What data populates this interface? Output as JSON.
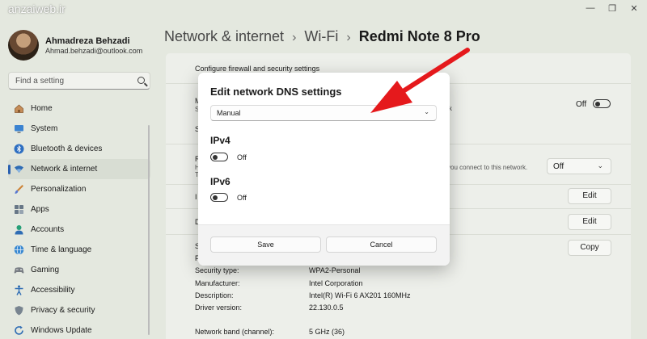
{
  "watermark": "anzaiweb.ir",
  "window": {
    "minimize": "—",
    "maximize": "❐",
    "close": "✕"
  },
  "profile": {
    "name": "Ahmadreza Behzadi",
    "email": "Ahmad.behzadi@outlook.com"
  },
  "search": {
    "placeholder": "Find a setting"
  },
  "sidebar": {
    "items": [
      {
        "label": "Home",
        "icon": "home-icon"
      },
      {
        "label": "System",
        "icon": "monitor-icon"
      },
      {
        "label": "Bluetooth & devices",
        "icon": "bluetooth-icon"
      },
      {
        "label": "Network & internet",
        "icon": "wifi-icon",
        "active": true
      },
      {
        "label": "Personalization",
        "icon": "brush-icon"
      },
      {
        "label": "Apps",
        "icon": "apps-icon"
      },
      {
        "label": "Accounts",
        "icon": "person-icon"
      },
      {
        "label": "Time & language",
        "icon": "globe-icon"
      },
      {
        "label": "Gaming",
        "icon": "gamepad-icon"
      },
      {
        "label": "Accessibility",
        "icon": "accessibility-icon"
      },
      {
        "label": "Privacy & security",
        "icon": "shield-icon"
      },
      {
        "label": "Windows Update",
        "icon": "update-icon"
      }
    ]
  },
  "breadcrumb": {
    "part1": "Network & internet",
    "sep1": "›",
    "part2": "Wi-Fi",
    "sep2": "›",
    "current": "Redmi Note 8 Pro"
  },
  "main": {
    "firewall_text": "Configure firewall and security settings",
    "row_m_partial": "M",
    "row_m_sub_partial": "S",
    "row_m_right": "k",
    "off_label": "Off",
    "row_s_partial": "S",
    "row_r_partial": "R",
    "row_r_sub1": "H",
    "row_r_sub2": "T",
    "row_r_right": "you connect to this network.",
    "dropdown_value": "Off",
    "row_ip_partial": "I",
    "row_dns_partial": "D",
    "edit_label": "Edit",
    "copy_label": "Copy",
    "row_s2_partial": "S",
    "row_p_partial": "P",
    "properties": [
      {
        "label": "Security type:",
        "value": "WPA2-Personal"
      },
      {
        "label": "Manufacturer:",
        "value": "Intel Corporation"
      },
      {
        "label": "Description:",
        "value": "Intel(R) Wi-Fi 6 AX201 160MHz"
      },
      {
        "label": "Driver version:",
        "value": "22.130.0.5"
      },
      {
        "label": "Network band (channel):",
        "value": "5 GHz (36)"
      }
    ]
  },
  "dialog": {
    "title": "Edit network DNS settings",
    "select_value": "Manual",
    "ipv4": {
      "heading": "IPv4",
      "toggle_label": "Off"
    },
    "ipv6": {
      "heading": "IPv6",
      "toggle_label": "Off"
    },
    "save_label": "Save",
    "cancel_label": "Cancel"
  },
  "colors": {
    "accent": "#2b63b5",
    "arrow": "#e5191c"
  }
}
